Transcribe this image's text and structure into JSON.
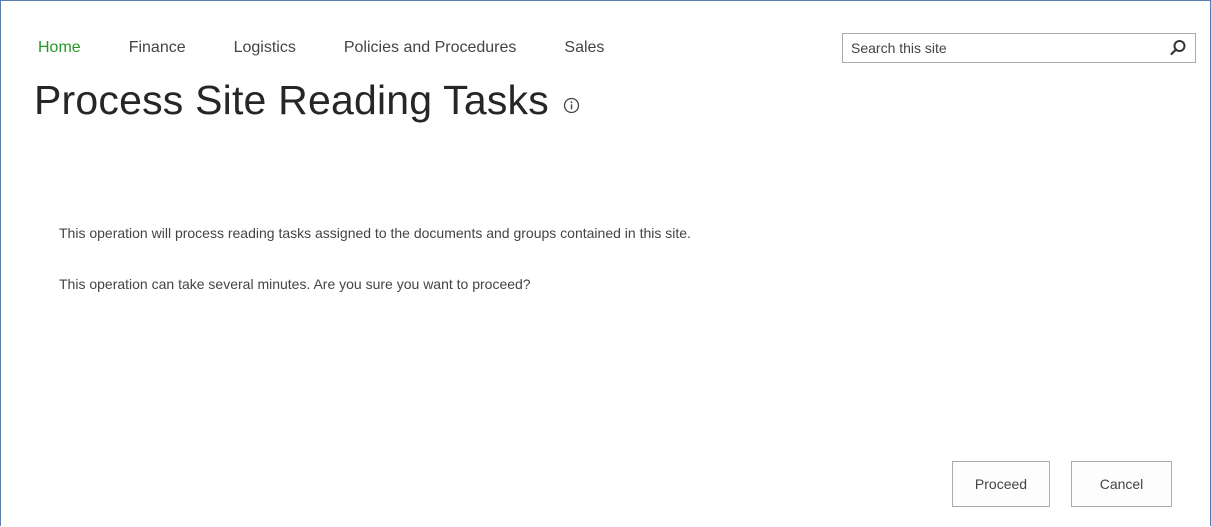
{
  "nav": {
    "items": [
      {
        "label": "Home",
        "active": true
      },
      {
        "label": "Finance",
        "active": false
      },
      {
        "label": "Logistics",
        "active": false
      },
      {
        "label": "Policies and Procedures",
        "active": false
      },
      {
        "label": "Sales",
        "active": false
      }
    ]
  },
  "search": {
    "placeholder": "Search this site",
    "value": "",
    "icon": "search-icon"
  },
  "page": {
    "title": "Process Site Reading Tasks",
    "title_icon": "info-icon"
  },
  "messages": {
    "line1": "This operation will process reading tasks assigned to the documents and groups contained in this site.",
    "line2": "This operation can take several minutes. Are you sure you want to proceed?"
  },
  "actions": {
    "proceed_label": "Proceed",
    "cancel_label": "Cancel"
  },
  "colors": {
    "active_nav": "#259925",
    "text": "#444444",
    "title": "#262626",
    "border": "#ababab",
    "frame": "#5b7db1"
  }
}
